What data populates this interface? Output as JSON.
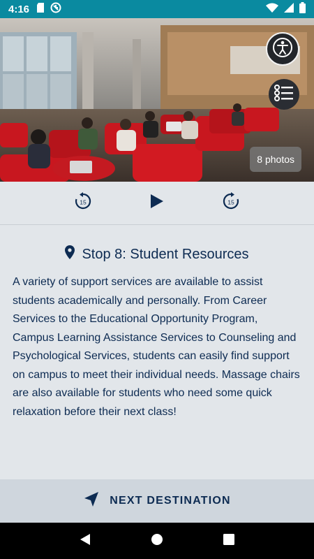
{
  "status_bar": {
    "time": "4:16",
    "left_icons": [
      "sd-card-icon",
      "vpn-icon"
    ],
    "right_icons": [
      "wifi-icon",
      "signal-icon",
      "battery-icon"
    ],
    "color": "#0a8aa0"
  },
  "hero": {
    "photos_label": "8 photos",
    "buttons": [
      "accessibility-icon",
      "list-icon"
    ]
  },
  "audio": {
    "rewind_seconds": "15",
    "forward_seconds": "15",
    "controls": [
      "replay-15-icon",
      "play-icon",
      "forward-15-icon"
    ]
  },
  "stop": {
    "title": "Stop 8: Student Resources",
    "description": "A variety of support services are available to assist students academically and personally. From Career Services to the Educational Opportunity Program, Campus Learning Assistance Services to Counseling and Psychological Services, students can easily find support on campus to meet their individual needs. Massage chairs are also available for students who need some quick relaxation before their next class!"
  },
  "next": {
    "label": "NEXT DESTINATION"
  },
  "colors": {
    "text_primary": "#0d2b52",
    "background": "#e2e6ea",
    "next_bar": "#cfd6dd"
  },
  "nav": [
    "back-icon",
    "home-icon",
    "recents-icon"
  ]
}
